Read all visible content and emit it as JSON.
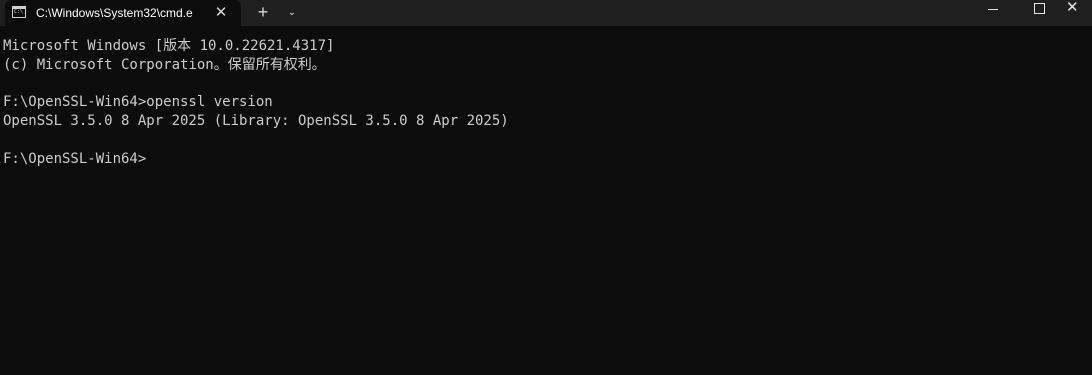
{
  "tab": {
    "title": "C:\\Windows\\System32\\cmd.e",
    "close_glyph": "✕"
  },
  "titlebar": {
    "new_tab_glyph": "+",
    "dropdown_glyph": "⌄",
    "close_glyph": "✕"
  },
  "console": {
    "lines": [
      "Microsoft Windows [版本 10.0.22621.4317]",
      "(c) Microsoft Corporation。保留所有权利。",
      "F:\\OpenSSL-Win64>openssl version",
      "OpenSSL 3.5.0 8 Apr 2025 (Library: OpenSSL 3.5.0 8 Apr 2025)",
      "F:\\OpenSSL-Win64>"
    ]
  },
  "icons": {
    "tab": "command-prompt-icon",
    "minimize": "minimize-icon",
    "maximize": "maximize-icon",
    "close": "close-icon"
  },
  "colors": {
    "background": "#0c0c0c",
    "titlebar": "#1f1f1f",
    "text": "#cccccc"
  }
}
